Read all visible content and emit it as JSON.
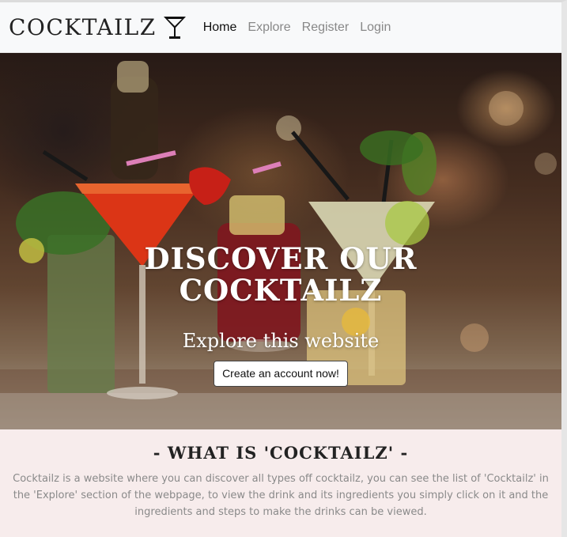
{
  "brand": {
    "name": "COCKTAILZ",
    "icon": "martini-glass-icon"
  },
  "nav": {
    "items": [
      {
        "label": "Home",
        "active": true
      },
      {
        "label": "Explore",
        "active": false
      },
      {
        "label": "Register",
        "active": false
      },
      {
        "label": "Login",
        "active": false
      }
    ]
  },
  "hero": {
    "title": "DISCOVER OUR COCKTAILZ",
    "subtitle": "Explore this website",
    "cta_label": "Create an account now!"
  },
  "about": {
    "title": "- WHAT IS 'COCKTAILZ' -",
    "text": "Cocktailz is a website where you can discover all types off cocktailz, you can see the list of 'Cocktailz' in the 'Explore' section of the webpage, to view the drink and its ingredients you simply click on it and the ingredients and steps to make the drinks can be viewed."
  },
  "colors": {
    "navbar_bg": "#f8f9fa",
    "about_bg": "#f7ecec",
    "nav_active": "#111111",
    "nav_inactive": "#888888"
  }
}
